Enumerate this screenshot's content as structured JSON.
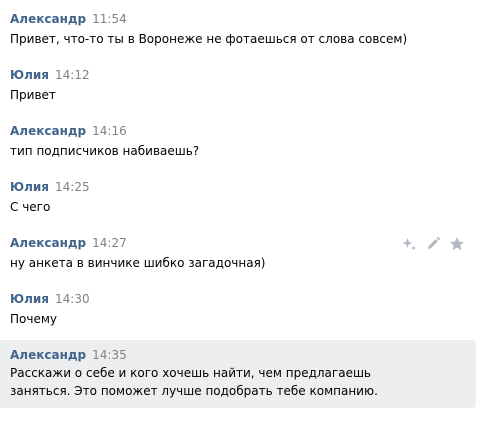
{
  "colors": {
    "author": "#42648b",
    "time": "#828282",
    "text": "#000000",
    "highlight": "#edeef0",
    "icon": "#b2b9c3"
  },
  "messages": [
    {
      "author": "Александр",
      "time": "11:54",
      "text": "Привет, что-то ты в Воронеже не фотаешься от слова совсем)"
    },
    {
      "author": "Юлия",
      "time": "14:12",
      "text": "Привет"
    },
    {
      "author": "Александр",
      "time": "14:16",
      "text": "тип подписчиков набиваешь?"
    },
    {
      "author": "Юлия",
      "time": "14:25",
      "text": "С чего"
    },
    {
      "author": "Александр",
      "time": "14:27",
      "text": "ну анкета в винчике шибко загадочная)"
    },
    {
      "author": "Юлия",
      "time": "14:30",
      "text": "Почему"
    },
    {
      "author": "Александр",
      "time": "14:35",
      "text": "Расскажи о себе и кого хочешь найти, чем предлагаешь\nзаняться. Это поможет лучше подобрать тебе компанию."
    }
  ],
  "actions": {
    "icons": [
      "sparkle-icon",
      "edit-icon",
      "favorite-star-icon"
    ]
  }
}
